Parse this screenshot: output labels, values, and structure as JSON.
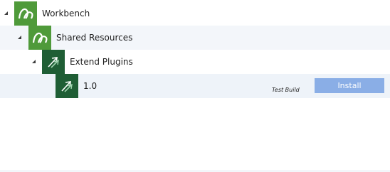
{
  "tree": {
    "root": {
      "label": "Workbench",
      "icon": "workbench-arc-icon",
      "expanded": true
    },
    "child": {
      "label": "Shared Resources",
      "icon": "workbench-arc-icon",
      "expanded": true
    },
    "grandchild": {
      "label": "Extend Plugins",
      "icon": "plugin-arrow-icon",
      "expanded": true
    },
    "leaf": {
      "label": "1.0",
      "icon": "plugin-arrow-icon",
      "build_tag": "Test Build",
      "action_label": "Install"
    }
  },
  "colors": {
    "green_icon": "#4f9a3a",
    "dark_icon": "#1f5e35",
    "install_button": "#8aaee6",
    "row_alt": "#f3f6fa"
  }
}
